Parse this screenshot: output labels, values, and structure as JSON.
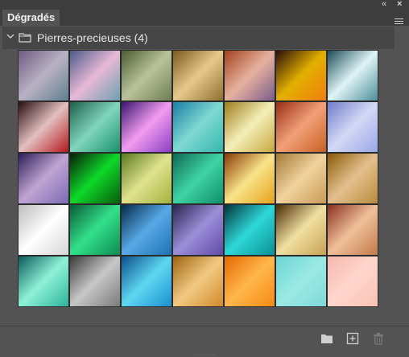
{
  "panel": {
    "tab_title": "Dégradés",
    "controls": {
      "collapse_icon": "collapse-double-arrow-icon",
      "close_icon": "close-icon",
      "menu_icon": "panel-menu-icon"
    }
  },
  "group": {
    "label": "Pierres-precieuses (4)",
    "icons": {
      "expand": "chevron-down-icon",
      "folder": "folder-icon"
    }
  },
  "gradients": [
    {
      "from": "#6e5a7e",
      "via": "#b9b2c4",
      "to": "#5f7e8e"
    },
    {
      "from": "#4b5a8a",
      "via": "#e8b9d6",
      "to": "#6d9fb0"
    },
    {
      "from": "#4c5c34",
      "via": "#b9c39a",
      "to": "#6f7d54"
    },
    {
      "from": "#7a5a1e",
      "via": "#e7c98e",
      "to": "#8e6f30"
    },
    {
      "from": "#a3421f",
      "via": "#e6b29e",
      "to": "#7b5b8c"
    },
    {
      "from": "#2a0d0d",
      "via": "#e2b000",
      "to": "#f07e0e"
    },
    {
      "from": "#1c4b59",
      "via": "#dff4f5",
      "to": "#4c8e99"
    },
    {
      "from": "#2a0d12",
      "via": "#e2c0c0",
      "to": "#b5171c"
    },
    {
      "from": "#1f5f4c",
      "via": "#7fd6bb",
      "to": "#1b8e6c"
    },
    {
      "from": "#3b1670",
      "via": "#f29cf0",
      "to": "#8a3fc2"
    },
    {
      "from": "#1b7ea6",
      "via": "#7fd9d2",
      "to": "#35b6ae"
    },
    {
      "from": "#a07d1d",
      "via": "#f3efb8",
      "to": "#c9a63e"
    },
    {
      "from": "#9a2e14",
      "via": "#f2a07a",
      "to": "#c76023"
    },
    {
      "from": "#6f7bc9",
      "via": "#d4d9f5",
      "to": "#9aa6e6"
    },
    {
      "from": "#2c1e58",
      "via": "#c0a4d2",
      "to": "#7b6bb7"
    },
    {
      "from": "#051f06",
      "via": "#0fd829",
      "to": "#045c0c"
    },
    {
      "from": "#5c7a1e",
      "via": "#dfe38e",
      "to": "#a4b13c"
    },
    {
      "from": "#0e6a52",
      "via": "#3fd3a4",
      "to": "#0f8f67"
    },
    {
      "from": "#8a3a05",
      "via": "#f7e38a",
      "to": "#e5a21b"
    },
    {
      "from": "#a37a35",
      "via": "#f0d39e",
      "to": "#c99a55"
    },
    {
      "from": "#8a5a06",
      "via": "#e3c08e",
      "to": "#b98a3b"
    },
    {
      "from": "#bcbcbc",
      "via": "#ffffff",
      "to": "#d6d6d6"
    },
    {
      "from": "#0a5c37",
      "via": "#33e08a",
      "to": "#0d8a51"
    },
    {
      "from": "#052a4a",
      "via": "#58a9e6",
      "to": "#1f70b0"
    },
    {
      "from": "#2b2350",
      "via": "#9b8fd8",
      "to": "#6149a8"
    },
    {
      "from": "#02343e",
      "via": "#2ed8d6",
      "to": "#0b8f97"
    },
    {
      "from": "#4a2a05",
      "via": "#f0e0a2",
      "to": "#c8a152"
    },
    {
      "from": "#8a2f20",
      "via": "#f0c09a",
      "to": "#c27a4a"
    },
    {
      "from": "#0b5a5c",
      "via": "#8ff2d6",
      "to": "#2cb39a"
    },
    {
      "from": "#3a3a3a",
      "via": "#c7c7c7",
      "to": "#7a7a7a"
    },
    {
      "from": "#0b4f8a",
      "via": "#5fd7f2",
      "to": "#1a8fcf"
    },
    {
      "from": "#9e6410",
      "via": "#f2c982",
      "to": "#d18a2a"
    },
    {
      "from": "#e46a00",
      "via": "#ffb64a",
      "to": "#f58a12"
    },
    {
      "from": "#6bd5d5",
      "via": "#9be9e5",
      "to": "#7ed9d8"
    },
    {
      "from": "#f7b7ad",
      "via": "#ffd6cc",
      "to": "#f9c2b6"
    }
  ],
  "footer": {
    "new_group_icon": "new-folder-icon",
    "new_gradient_icon": "new-gradient-icon",
    "delete_icon": "trash-icon"
  }
}
